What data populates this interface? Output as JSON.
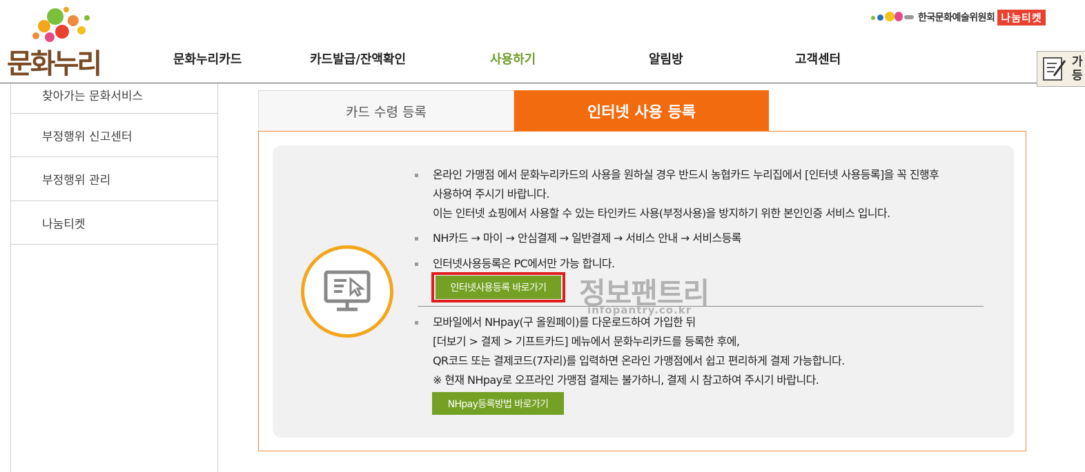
{
  "header": {
    "logo_text": "문화누리",
    "nav": [
      {
        "label": "문화누리카드",
        "active": false
      },
      {
        "label": "카드발급/잔액확인",
        "active": false
      },
      {
        "label": "사용하기",
        "active": true
      },
      {
        "label": "알림방",
        "active": false
      },
      {
        "label": "고객센터",
        "active": false
      }
    ],
    "org_name": "한국문화예술위원회",
    "nanum_ticket": "나눔티켓",
    "side_badge": "가\n등",
    "accent_active": "#6e9c2a"
  },
  "sidebar": {
    "items": [
      {
        "label": "찾아가는 문화서비스"
      },
      {
        "label": "부정행위 신고센터"
      },
      {
        "label": "부정행위 관리"
      },
      {
        "label": "나눔티켓"
      }
    ]
  },
  "tabs": [
    {
      "label": "카드 수령 등록",
      "active": false
    },
    {
      "label": "인터넷 사용 등록",
      "active": true
    }
  ],
  "content": {
    "icon": "monitor-cursor-icon",
    "bullets": [
      {
        "lines": [
          "온라인 가맹점 에서 문화누리카드의 사용을 원하실 경우 반드시 농협카드 누리집에서 [인터넷 사용등록]을 꼭 진행후",
          "사용하여 주시기 바랍니다.",
          "이는 인터넷 쇼핑에서 사용할 수 있는 타인카드 사용(부정사용)을 방지하기 위한 본인인증 서비스 입니다."
        ]
      },
      {
        "lines": [
          "NH카드 → 마이 → 안심결제 → 일반결제 → 서비스 안내 → 서비스등록"
        ]
      },
      {
        "lines": [
          "인터넷사용등록은 PC에서만 가능 합니다."
        ]
      },
      {
        "lines": [
          "모바일에서 NHpay(구 올원페이)를 다운로드하여 가입한 뒤",
          "[더보기 > 결제 > 기프트카드] 메뉴에서 문화누리카드를 등록한 후에,",
          "QR코드 또는 결제코드(7자리)를 입력하면 온라인 가맹점에서 쉽고 편리하게 결제 가능합니다.",
          "※ 현재 NHpay로 오프라인 가맹점 결제는 불가하니, 결제 시 참고하여 주시기 바랍니다."
        ]
      }
    ],
    "button_internet": "인터넷사용등록 바로가기",
    "button_nhpay": "NHpay등록방법 바로가기"
  },
  "watermark": {
    "main": "정보팬트리",
    "sub": "infopantry.co.kr"
  },
  "colors": {
    "tab_active": "#f26b0f",
    "button_green": "#74a023",
    "highlight_red": "#e21c1c",
    "circle_yellow": "#f3a61c"
  }
}
